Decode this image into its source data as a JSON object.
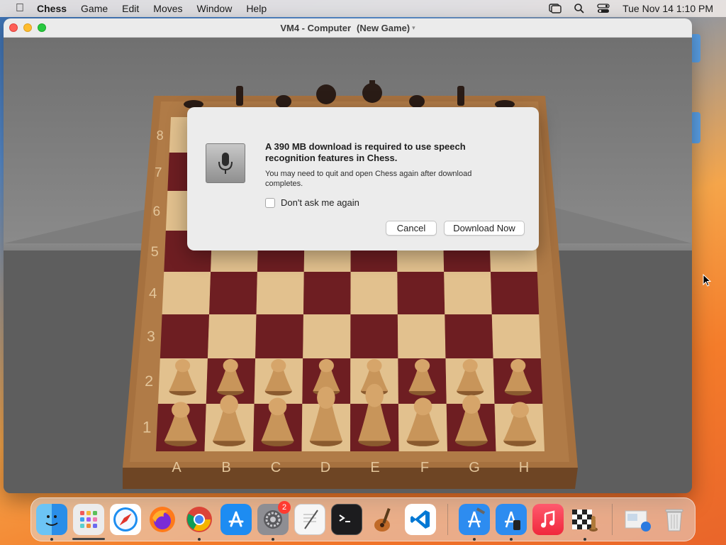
{
  "menubar": {
    "app_name": "Chess",
    "menus": [
      "Game",
      "Edit",
      "Moves",
      "Window",
      "Help"
    ],
    "clock": "Tue Nov 14  1:10 PM"
  },
  "window": {
    "title": "VM4 - Computer",
    "subtitle": "(New Game)"
  },
  "board": {
    "ranks": [
      "8",
      "7",
      "6",
      "5",
      "4",
      "3",
      "2",
      "1"
    ],
    "files": [
      "A",
      "B",
      "C",
      "D",
      "E",
      "F",
      "G",
      "H"
    ]
  },
  "dialog": {
    "heading": "A 390 MB download is required to use speech recognition features in Chess.",
    "body": "You may need to quit and open Chess again after download completes.",
    "checkbox_label": "Don't ask me again",
    "cancel_label": "Cancel",
    "download_label": "Download Now"
  },
  "dock": {
    "items": [
      "finder",
      "launchpad",
      "safari",
      "firefox",
      "chrome",
      "app-store",
      "system-settings",
      "textedit",
      "terminal",
      "instruments",
      "vscode",
      "xcode",
      "simulator",
      "music",
      "chess",
      "preview",
      "trash"
    ],
    "system_settings_badge": "2"
  },
  "colors": {
    "dark_square": "#6e1e22",
    "light_square": "#e2c18e",
    "board_frame": "#9a6a3a",
    "piece_white": "#c8955a"
  }
}
